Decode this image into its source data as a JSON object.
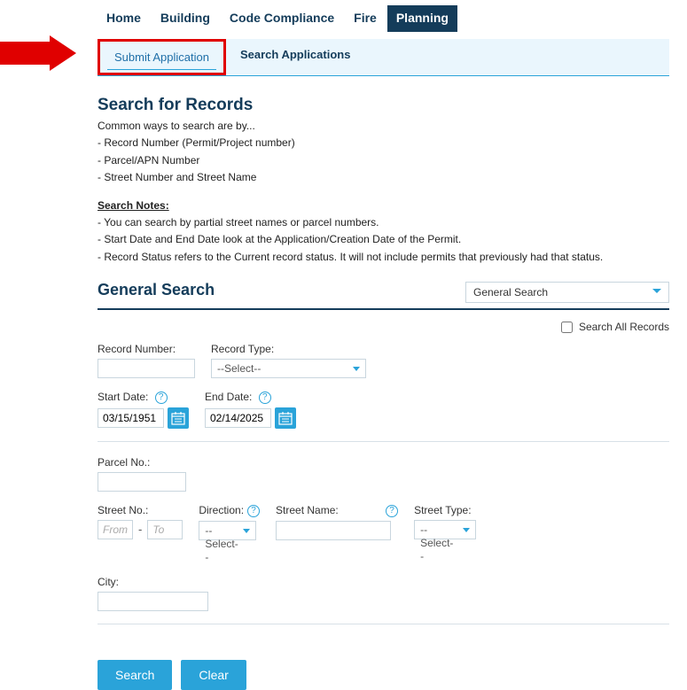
{
  "nav": {
    "items": [
      {
        "label": "Home"
      },
      {
        "label": "Building"
      },
      {
        "label": "Code Compliance"
      },
      {
        "label": "Fire"
      },
      {
        "label": "Planning"
      }
    ]
  },
  "subtabs": {
    "submit": "Submit Application",
    "search": "Search Applications"
  },
  "searchRecords": {
    "title": "Search for Records",
    "intro": "Common ways to search are by...",
    "bullets": [
      "- Record Number (Permit/Project number)",
      "- Parcel/APN Number",
      "- Street Number and Street Name"
    ],
    "notesHead": "Search Notes:",
    "notes": [
      "- You can search by partial street names or parcel numbers.",
      "- Start Date and End Date look at the Application/Creation Date of the Permit.",
      "- Record Status refers to the Current record status. It will not include permits that previously had that status."
    ]
  },
  "generalSearch": {
    "title": "General Search",
    "dropdown": "General Search",
    "searchAll": "Search All Records"
  },
  "form": {
    "recordNumber": {
      "label": "Record Number:"
    },
    "recordType": {
      "label": "Record Type:",
      "value": "--Select--"
    },
    "startDate": {
      "label": "Start Date:",
      "value": "03/15/1951"
    },
    "endDate": {
      "label": "End Date:",
      "value": "02/14/2025"
    },
    "parcel": {
      "label": "Parcel No.:"
    },
    "streetNo": {
      "label": "Street No.:",
      "fromPH": "From",
      "toPH": "To"
    },
    "direction": {
      "label": "Direction:",
      "value": "--Select--"
    },
    "streetName": {
      "label": "Street Name:"
    },
    "streetType": {
      "label": "Street Type:",
      "value": "--Select--"
    },
    "city": {
      "label": "City:"
    }
  },
  "buttons": {
    "search": "Search",
    "clear": "Clear"
  },
  "help": "?"
}
